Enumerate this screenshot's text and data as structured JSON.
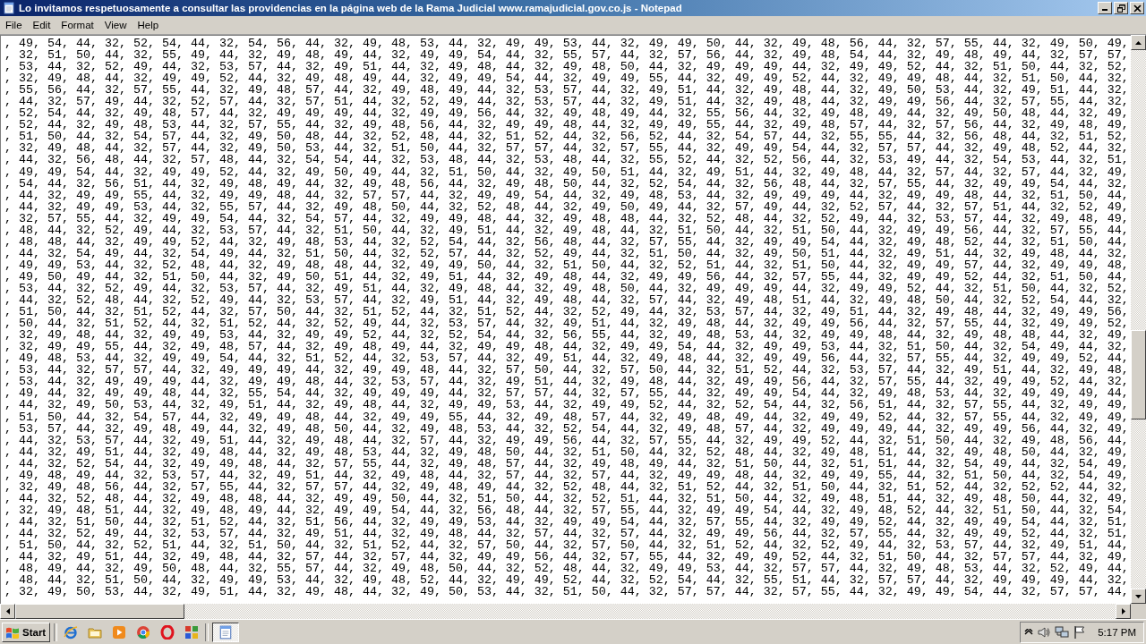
{
  "window": {
    "title": "Lo invitamos respetuosamente a consultar las providencias en la página web de la Rama Judicial www.ramajudicial.gov.co.js - Notepad"
  },
  "menu": [
    "File",
    "Edit",
    "Format",
    "View",
    "Help"
  ],
  "editor": {
    "lines": [
      ", 49, 54, 44, 32, 52, 54, 44, 32, 54, 56, 44, 32, 49, 48, 53, 44, 32, 49, 49, 53, 44, 32, 49, 49, 50, 44, 32, 49, 48, 56, 44, 32, 57, 55, 44, 32, 49, 50, 49,",
      ", 32, 51, 50, 44, 32, 55, 49, 44, 32, 49, 48, 49, 44, 32, 49, 49, 54, 44, 32, 55, 57, 44, 32, 57, 56, 44, 32, 49, 48, 54, 44, 32, 49, 48, 49, 44, 32, 57, 57,",
      ", 53, 44, 32, 52, 49, 44, 32, 53, 57, 44, 32, 49, 51, 44, 32, 49, 48, 44, 32, 49, 48, 50, 44, 32, 49, 49, 49, 44, 32, 49, 49, 52, 44, 32, 51, 50, 44, 32, 52,",
      ", 32, 49, 48, 44, 32, 49, 49, 52, 44, 32, 49, 48, 49, 44, 32, 49, 49, 54, 44, 32, 49, 49, 55, 44, 32, 49, 49, 52, 44, 32, 49, 49, 48, 44, 32, 51, 50, 44, 32,",
      ", 55, 56, 44, 32, 57, 55, 44, 32, 49, 48, 57, 44, 32, 49, 48, 49, 44, 32, 53, 57, 44, 32, 49, 51, 44, 32, 49, 48, 44, 32, 49, 50, 53, 44, 32, 49, 51, 44, 32,",
      ", 44, 32, 57, 49, 44, 32, 52, 57, 44, 32, 57, 51, 44, 32, 52, 49, 44, 32, 53, 57, 44, 32, 49, 51, 44, 32, 49, 48, 44, 32, 49, 49, 56, 44, 32, 57, 55, 44, 32,",
      ", 52, 54, 44, 32, 49, 48, 57, 44, 32, 49, 49, 49, 44, 32, 49, 49, 56, 44, 32, 49, 48, 49, 44, 32, 55, 56, 44, 32, 49, 48, 49, 44, 32, 49, 50, 48, 44, 32, 49,",
      ", 52, 44, 32, 49, 48, 53, 44, 32, 57, 55, 44, 32, 49, 48, 56, 44, 32, 49, 49, 48, 44, 32, 49, 49, 55, 44, 32, 49, 48, 57, 44, 32, 57, 56, 44, 32, 49, 48, 49,",
      ", 51, 50, 44, 32, 54, 57, 44, 32, 49, 50, 48, 44, 32, 52, 48, 44, 32, 51, 52, 44, 32, 56, 52, 44, 32, 54, 57, 44, 32, 55, 55, 44, 32, 56, 48, 44, 32, 51, 52,",
      ", 32, 49, 48, 44, 32, 57, 44, 32, 49, 50, 53, 44, 32, 51, 50, 44, 32, 57, 57, 44, 32, 57, 55, 44, 32, 49, 49, 54, 44, 32, 57, 57, 44, 32, 49, 48, 52, 44, 32,",
      ", 44, 32, 56, 48, 44, 32, 57, 48, 44, 32, 54, 54, 44, 32, 53, 48, 44, 32, 53, 48, 44, 32, 55, 52, 44, 32, 52, 56, 44, 32, 53, 49, 44, 32, 54, 53, 44, 32, 51,",
      ", 49, 49, 54, 44, 32, 49, 49, 52, 44, 32, 49, 50, 49, 44, 32, 51, 50, 44, 32, 49, 50, 51, 44, 32, 49, 51, 44, 32, 49, 48, 44, 32, 57, 44, 32, 57, 44, 32, 49,",
      ", 54, 44, 32, 56, 51, 44, 32, 49, 48, 49, 44, 32, 49, 48, 56, 44, 32, 49, 48, 50, 44, 32, 52, 54, 44, 32, 56, 48, 44, 32, 57, 55, 44, 32, 49, 49, 54, 44, 32,",
      ", 44, 32, 49, 49, 55, 44, 32, 49, 49, 48, 44, 32, 57, 57, 44, 32, 49, 49, 54, 44, 32, 49, 48, 53, 44, 32, 49, 49, 49, 44, 32, 49, 49, 48, 44, 32, 51, 50, 44,",
      ", 44, 32, 49, 49, 53, 44, 32, 55, 57, 44, 32, 49, 48, 50, 44, 32, 52, 48, 44, 32, 49, 50, 49, 44, 32, 57, 49, 44, 32, 52, 57, 44, 32, 57, 51, 44, 32, 52, 49,",
      ", 32, 57, 55, 44, 32, 49, 49, 54, 44, 32, 54, 57, 44, 32, 49, 49, 48, 44, 32, 49, 48, 48, 44, 32, 52, 48, 44, 32, 52, 49, 44, 32, 53, 57, 44, 32, 49, 48, 49,",
      ", 48, 44, 32, 52, 49, 44, 32, 53, 57, 44, 32, 51, 50, 44, 32, 49, 51, 44, 32, 49, 48, 44, 32, 51, 50, 44, 32, 51, 50, 44, 32, 49, 49, 56, 44, 32, 57, 55, 44,",
      ", 48, 48, 44, 32, 49, 49, 52, 44, 32, 49, 48, 53, 44, 32, 52, 54, 44, 32, 56, 48, 44, 32, 57, 55, 44, 32, 49, 49, 54, 44, 32, 49, 48, 52, 44, 32, 51, 50, 44,",
      ", 44, 32, 54, 49, 44, 32, 54, 49, 44, 32, 51, 50, 44, 32, 52, 57, 44, 32, 52, 49, 44, 32, 51, 50, 44, 32, 49, 50, 51, 44, 32, 49, 51, 44, 32, 49, 48, 44, 32,",
      ", 49, 49, 53, 44, 32, 52, 48, 44, 32, 49, 48, 48, 44, 32, 49, 49, 50, 44, 32, 51, 50, 44, 32, 52, 51, 44, 32, 51, 50, 44, 32, 49, 49, 57, 44, 32, 49, 49, 48,",
      ", 49, 50, 49, 44, 32, 51, 50, 44, 32, 49, 50, 51, 44, 32, 49, 51, 44, 32, 49, 48, 44, 32, 49, 49, 56, 44, 32, 57, 55, 44, 32, 49, 49, 52, 44, 32, 51, 50, 44,",
      ", 53, 44, 32, 52, 49, 44, 32, 53, 57, 44, 32, 49, 51, 44, 32, 49, 48, 44, 32, 49, 48, 50, 44, 32, 49, 49, 49, 44, 32, 49, 49, 52, 44, 32, 51, 50, 44, 32, 52,",
      ", 44, 32, 52, 48, 44, 32, 52, 49, 44, 32, 53, 57, 44, 32, 49, 51, 44, 32, 49, 48, 44, 32, 57, 44, 32, 49, 48, 51, 44, 32, 49, 48, 50, 44, 32, 52, 54, 44, 32,",
      ", 51, 50, 44, 32, 51, 52, 44, 32, 57, 50, 44, 32, 51, 52, 44, 32, 51, 52, 44, 32, 52, 49, 44, 32, 53, 57, 44, 32, 49, 51, 44, 32, 49, 48, 44, 32, 49, 49, 56,",
      ", 50, 44, 32, 51, 52, 44, 32, 51, 52, 44, 32, 52, 49, 44, 32, 53, 57, 44, 32, 49, 51, 44, 32, 49, 48, 44, 32, 49, 49, 56, 44, 32, 57, 55, 44, 32, 49, 49, 52,",
      ", 32, 49, 48, 44, 32, 49, 49, 53, 44, 32, 49, 49, 52, 44, 32, 52, 54, 44, 32, 56, 55, 44, 32, 49, 48, 53, 44, 32, 49, 49, 48, 44, 32, 49, 48, 48, 44, 32, 49,",
      ", 32, 49, 49, 55, 44, 32, 49, 48, 57, 44, 32, 49, 48, 49, 44, 32, 49, 49, 48, 44, 32, 49, 49, 54, 44, 32, 49, 49, 53, 44, 32, 51, 50, 44, 32, 54, 49, 44, 32,",
      ", 49, 48, 53, 44, 32, 49, 49, 54, 44, 32, 51, 52, 44, 32, 53, 57, 44, 32, 49, 51, 44, 32, 49, 48, 44, 32, 49, 49, 56, 44, 32, 57, 55, 44, 32, 49, 49, 52, 44,",
      ", 53, 44, 32, 57, 57, 44, 32, 49, 49, 49, 44, 32, 49, 49, 48, 44, 32, 57, 50, 44, 32, 57, 50, 44, 32, 51, 52, 44, 32, 53, 57, 44, 32, 49, 51, 44, 32, 49, 48,",
      ", 53, 44, 32, 49, 49, 49, 44, 32, 49, 49, 48, 44, 32, 53, 57, 44, 32, 49, 51, 44, 32, 49, 48, 44, 32, 49, 49, 56, 44, 32, 57, 55, 44, 32, 49, 49, 52, 44, 32,",
      ", 49, 44, 32, 49, 49, 48, 44, 32, 55, 54, 44, 32, 49, 49, 49, 44, 32, 57, 57, 44, 32, 57, 55, 44, 32, 49, 49, 54, 44, 32, 49, 48, 53, 44, 32, 49, 49, 49, 44,",
      ", 44, 32, 49, 50, 53, 44, 32, 49, 51, 44, 32, 49, 48, 44, 32, 49, 49, 53, 44, 32, 49, 49, 52, 44, 32, 52, 54, 44, 32, 56, 51, 44, 32, 57, 55, 44, 32, 49, 49,",
      ", 51, 50, 44, 32, 54, 57, 44, 32, 49, 49, 48, 44, 32, 49, 49, 55, 44, 32, 49, 48, 57, 44, 32, 49, 48, 49, 44, 32, 49, 49, 52, 44, 32, 57, 55, 44, 32, 49, 49,",
      ", 53, 57, 44, 32, 49, 48, 49, 44, 32, 49, 48, 50, 44, 32, 49, 48, 53, 44, 32, 52, 54, 44, 32, 49, 48, 57, 44, 32, 49, 49, 49, 44, 32, 49, 49, 56, 44, 32, 49,",
      ", 44, 32, 53, 57, 44, 32, 49, 51, 44, 32, 49, 48, 44, 32, 57, 44, 32, 49, 49, 56, 44, 32, 57, 55, 44, 32, 49, 49, 52, 44, 32, 51, 50, 44, 32, 49, 48, 56, 44,",
      ", 44, 32, 49, 51, 44, 32, 49, 48, 44, 32, 49, 48, 53, 44, 32, 49, 48, 50, 44, 32, 51, 50, 44, 32, 52, 48, 44, 32, 49, 48, 51, 44, 32, 49, 48, 50, 44, 32, 49,",
      ", 44, 32, 52, 54, 44, 32, 49, 49, 48, 44, 32, 57, 55, 44, 32, 49, 48, 57, 44, 32, 49, 48, 49, 44, 32, 51, 50, 44, 32, 51, 51, 44, 32, 54, 49, 44, 32, 54, 49,",
      ", 49, 48, 49, 44, 32, 53, 57, 44, 32, 49, 51, 44, 32, 49, 48, 44, 32, 57, 44, 32, 57, 44, 32, 49, 49, 48, 44, 32, 49, 49, 55, 44, 32, 51, 50, 44, 32, 54, 49,",
      ", 32, 49, 48, 56, 44, 32, 57, 55, 44, 32, 57, 57, 44, 32, 49, 48, 49, 44, 32, 52, 48, 44, 32, 51, 52, 44, 32, 51, 50, 44, 32, 51, 52, 44, 32, 52, 52, 44, 32,",
      ", 44, 32, 52, 48, 44, 32, 49, 48, 48, 44, 32, 49, 49, 50, 44, 32, 51, 50, 44, 32, 52, 51, 44, 32, 51, 50, 44, 32, 49, 48, 51, 44, 32, 49, 48, 50, 44, 32, 49,",
      ", 32, 49, 48, 51, 44, 32, 49, 48, 49, 44, 32, 49, 49, 54, 44, 32, 56, 48, 44, 32, 57, 55, 44, 32, 49, 49, 54, 44, 32, 49, 48, 52, 44, 32, 51, 50, 44, 32, 54,",
      ", 44, 32, 51, 50, 44, 32, 51, 52, 44, 32, 51, 56, 44, 32, 49, 49, 53, 44, 32, 49, 49, 54, 44, 32, 57, 55, 44, 32, 49, 49, 52, 44, 32, 49, 49, 54, 44, 32, 51,",
      ", 44, 32, 52, 49, 44, 32, 53, 57, 44, 32, 49, 51, 44, 32, 49, 48, 44, 32, 57, 44, 32, 57, 44, 32, 49, 49, 56, 44, 32, 57, 55, 44, 32, 49, 49, 52, 44, 32, 51,",
      ", 51, 50, 44, 32, 52, 51, 44, 32, 51, 50, 44, 32, 51, 52, 44, 32, 57, 50, 44, 32, 57, 50, 44, 32, 51, 52, 44, 32, 52, 49, 44, 32, 53, 57, 44, 32, 49, 51, 44,",
      ", 44, 32, 49, 51, 44, 32, 49, 48, 44, 32, 57, 44, 32, 57, 44, 32, 49, 49, 56, 44, 32, 57, 55, 44, 32, 49, 49, 52, 44, 32, 51, 50, 44, 32, 57, 57, 44, 32, 49,",
      ", 48, 49, 44, 32, 49, 50, 48, 44, 32, 55, 57, 44, 32, 49, 48, 50, 44, 32, 52, 48, 44, 32, 49, 49, 53, 44, 32, 57, 57, 44, 32, 49, 48, 53, 44, 32, 52, 49, 44,",
      ", 48, 44, 32, 51, 50, 44, 32, 49, 49, 53, 44, 32, 49, 48, 52, 44, 32, 49, 49, 52, 44, 32, 52, 54, 44, 32, 55, 51, 44, 32, 57, 57, 44, 32, 49, 49, 49, 44, 32,",
      ", 32, 49, 50, 53, 44, 32, 49, 51, 44, 32, 49, 48, 44, 32, 49, 50, 53, 44, 32, 51, 50, 44, 32, 57, 57, 44, 32, 57, 55, 44, 32, 49, 49, 54, 44, 32, 57, 57, 44,"
    ]
  },
  "taskbar": {
    "start": "Start",
    "tasks": [
      {
        "selected": true
      }
    ],
    "clock": "5:17 PM"
  }
}
